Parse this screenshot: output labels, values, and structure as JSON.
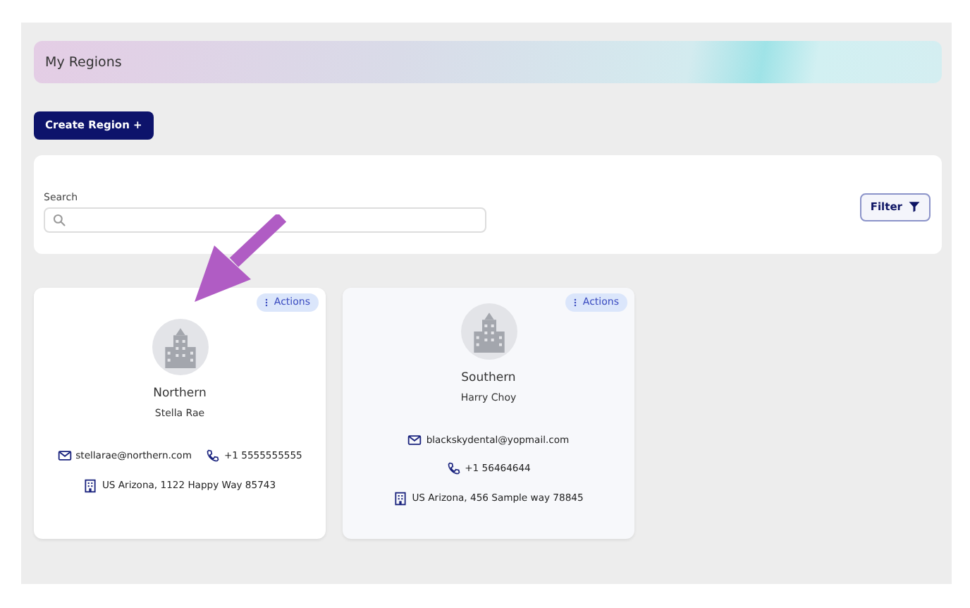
{
  "header": {
    "title": "My Regions"
  },
  "create_button": {
    "label": "Create Region +"
  },
  "search": {
    "label": "Search"
  },
  "filter_button": {
    "label": "Filter"
  },
  "regions": [
    {
      "name": "Northern",
      "manager": "Stella Rae",
      "email": "stellarae@northern.com",
      "phone": "+1 5555555555",
      "address": "US Arizona, 1122 Happy Way 85743",
      "actions": "Actions",
      "highlighted": false
    },
    {
      "name": "Southern",
      "manager": "Harry Choy",
      "email": "blackskydental@yopmail.com",
      "phone": "+1 56464644",
      "address": "US Arizona, 456 Sample way 78845",
      "actions": "Actions",
      "highlighted": true
    }
  ],
  "annotation": {
    "kind": "arrow"
  }
}
